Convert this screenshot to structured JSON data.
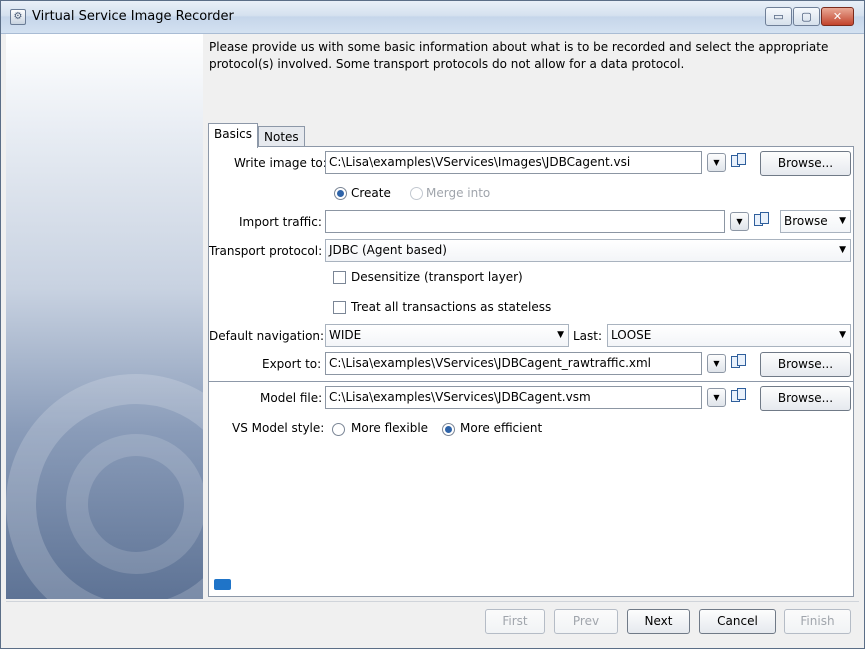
{
  "window": {
    "title": "Virtual Service Image Recorder",
    "controls": [
      "▭",
      "▢",
      "✕"
    ]
  },
  "intro": "Please provide us with some basic information about what is to be recorded and select the appropriate protocol(s) involved.  Some transport protocols do not allow for a data protocol.",
  "tabs": [
    "Basics",
    "Notes"
  ],
  "form": {
    "write_image_label": "Write image to:",
    "write_image_value": "C:\\Lisa\\examples\\VServices\\Images\\JDBCagent.vsi",
    "browse_label": "Browse...",
    "create_label": "Create",
    "merge_label": "Merge into",
    "import_traffic_label": "Import traffic:",
    "import_traffic_value": "",
    "browse_short_label": "Browse",
    "transport_label": "Transport protocol:",
    "transport_value": "JDBC (Agent based)",
    "desensitize_label": "Desensitize (transport layer)",
    "stateless_label": "Treat all transactions as stateless",
    "default_nav_label": "Default navigation:",
    "default_nav_value": "WIDE",
    "last_label": "Last:",
    "last_value": "LOOSE",
    "export_label": "Export to:",
    "export_value": "C:\\Lisa\\examples\\VServices\\JDBCagent_rawtraffic.xml",
    "model_file_label": "Model file:",
    "model_file_value": "C:\\Lisa\\examples\\VServices\\JDBCagent.vsm",
    "vs_model_style_label": "VS Model style:",
    "more_flexible_label": "More flexible",
    "more_efficient_label": "More efficient"
  },
  "footer": {
    "first": "First",
    "prev": "Prev",
    "next": "Next",
    "cancel": "Cancel",
    "finish": "Finish"
  }
}
